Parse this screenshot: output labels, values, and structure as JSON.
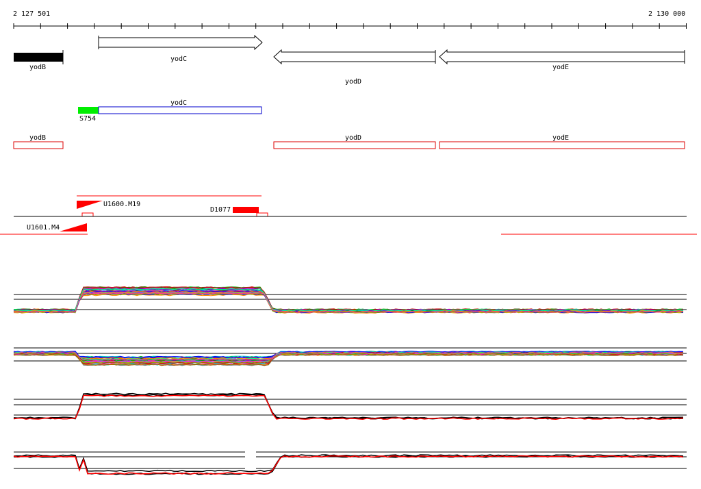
{
  "ruler": {
    "start_label": "2 127 501",
    "end_label": "2 130 000"
  },
  "genes": {
    "yodB": "yodB",
    "yodC": "yodC",
    "yodD": "yodD",
    "yodE": "yodE"
  },
  "transcript": {
    "gene_label": "yodC",
    "promoter_label": "S754"
  },
  "cds_boxes": {
    "yodB": "yodB",
    "yodD": "yodD",
    "yodE": "yodE"
  },
  "probes": {
    "forward": "U1600.M19",
    "reverse": "U1601.M4",
    "deletion": "D1077"
  },
  "colors": {
    "gene_fill_black": "#000000",
    "promoter_green": "#00ee00",
    "transcript_blue": "#0000cc",
    "cds_red": "#dd0000",
    "probe_red": "#ff0000"
  },
  "expression_panels": {
    "count": 4,
    "note_series": "many colored tiling array profiles"
  }
}
